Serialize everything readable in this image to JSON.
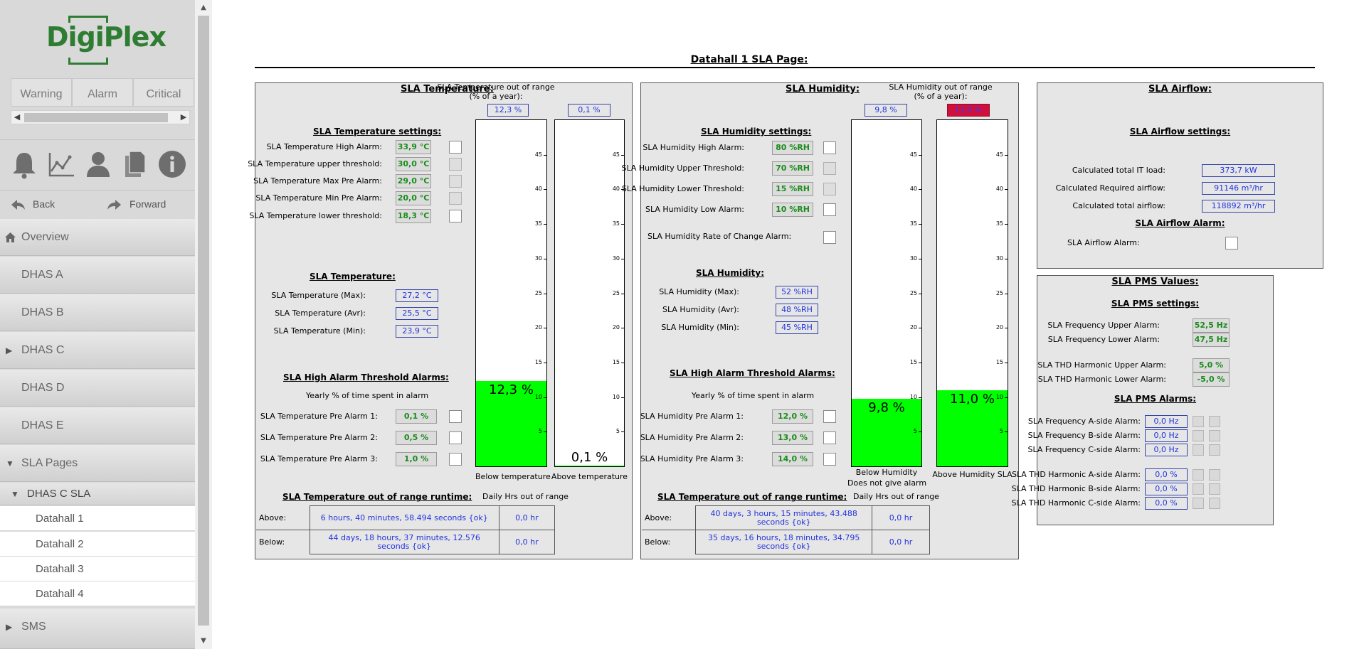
{
  "sidebar": {
    "logo_text": "DigiPlex",
    "tabs": [
      "Warning",
      "Alarm",
      "Critical"
    ],
    "icons": [
      "bell-icon",
      "chart-line-icon",
      "user-icon",
      "documents-icon",
      "info-icon"
    ],
    "back_label": "Back",
    "forward_label": "Forward",
    "menu": [
      {
        "label": "Overview",
        "icon": "home-icon"
      },
      {
        "label": "DHAS A"
      },
      {
        "label": "DHAS B"
      },
      {
        "label": "DHAS C",
        "chevron": "▶"
      },
      {
        "label": "DHAS D"
      },
      {
        "label": "DHAS E"
      },
      {
        "label": "SLA Pages",
        "chevron": "▼"
      }
    ],
    "submenu_head": {
      "label": "DHAS C SLA",
      "chevron": "▼"
    },
    "submenu_items": [
      "Datahall 1",
      "Datahall 2",
      "Datahall 3",
      "Datahall 4"
    ],
    "last_menu": {
      "label": "SMS",
      "chevron": "▶"
    }
  },
  "page": {
    "title": "Datahall 1 SLA Page:"
  },
  "temperature": {
    "title": "SLA Temperature:",
    "out_of_range_title": "SLA Temperature out of range",
    "out_of_range_sub": "(% of a year):",
    "below_pct": "12,3 %",
    "above_pct": "0,1 %",
    "settings_title": "SLA Temperature settings:",
    "settings": [
      {
        "label": "SLA Temperature High Alarm:",
        "value": "33,9 °C"
      },
      {
        "label": "SLA Temperature upper threshold:",
        "value": "30,0 °C"
      },
      {
        "label": "SLA Temperature Max Pre Alarm:",
        "value": "29,0 °C"
      },
      {
        "label": "SLA Temperature Min Pre Alarm:",
        "value": "20,0 °C"
      },
      {
        "label": "SLA Temperature lower threshold:",
        "value": "18,3 °C"
      }
    ],
    "current_title": "SLA Temperature:",
    "current": [
      {
        "label": "SLA Temperature (Max):",
        "value": "27,2 °C"
      },
      {
        "label": "SLA Temperature (Avr):",
        "value": "25,5 °C"
      },
      {
        "label": "SLA Temperature (Min):",
        "value": "23,9 °C"
      }
    ],
    "high_alarm_title": "SLA High Alarm Threshold Alarms:",
    "yearly_label": "Yearly % of time spent in alarm",
    "pre_alarms": [
      {
        "label": "SLA Temperature Pre Alarm 1:",
        "value": "0,1 %"
      },
      {
        "label": "SLA Temperature Pre Alarm 2:",
        "value": "0,5 %"
      },
      {
        "label": "SLA Temperature Pre Alarm 3:",
        "value": "1,0 %"
      }
    ],
    "bars": [
      {
        "value": 12.3,
        "label": "12,3 %",
        "caption": "Below temperature"
      },
      {
        "value": 0.1,
        "label": "0,1 %",
        "caption": "Above temperature"
      }
    ],
    "runtime_title": "SLA Temperature out of range runtime:",
    "daily_label": "Daily Hrs out of range",
    "runtime": [
      {
        "label": "Above:",
        "value": "6 hours, 40 minutes, 58.494 seconds {ok}",
        "daily": "0,0 hr"
      },
      {
        "label": "Below:",
        "value": "44 days, 18 hours, 37 minutes, 12.576 seconds {ok}",
        "daily": "0,0 hr"
      }
    ]
  },
  "humidity": {
    "title": "SLA Humidity:",
    "out_of_range_title": "SLA Humidity out of range",
    "out_of_range_sub": "(% of a year):",
    "below_pct": "9,8 %",
    "above_pct": "11,0 %",
    "settings_title": "SLA Humidity settings:",
    "settings": [
      {
        "label": "SLA Humidity High Alarm:",
        "value": "80 %RH"
      },
      {
        "label": "SLA Humidity Upper Threshold:",
        "value": "70 %RH"
      },
      {
        "label": "SLA Humidity Lower Threshold:",
        "value": "15 %RH"
      },
      {
        "label": "SLA Humidity Low Alarm:",
        "value": "10 %RH"
      }
    ],
    "rate_label": "SLA Humidity Rate of Change Alarm:",
    "current_title": "SLA Humidity:",
    "current": [
      {
        "label": "SLA Humidity (Max):",
        "value": "52 %RH"
      },
      {
        "label": "SLA Humidity (Avr):",
        "value": "48 %RH"
      },
      {
        "label": "SLA Humidity (Min):",
        "value": "45 %RH"
      }
    ],
    "high_alarm_title": "SLA High Alarm Threshold Alarms:",
    "yearly_label": "Yearly % of time spent in alarm",
    "pre_alarms": [
      {
        "label": "SLA Humidity Pre Alarm 1:",
        "value": "12,0 %"
      },
      {
        "label": "SLA Humidity Pre Alarm 2:",
        "value": "13,0 %"
      },
      {
        "label": "SLA Humidity Pre Alarm 3:",
        "value": "14,0 %"
      }
    ],
    "bars": [
      {
        "value": 9.8,
        "label": "9,8 %",
        "caption": "Below Humidity",
        "caption2": "Does not give alarm"
      },
      {
        "value": 11.0,
        "label": "11,0 %",
        "caption": "Above Humidity SLA"
      }
    ],
    "runtime_title": "SLA Temperature out of range runtime:",
    "daily_label": "Daily Hrs out of range",
    "runtime": [
      {
        "label": "Above:",
        "value": "40 days, 3 hours, 15 minutes, 43.488 seconds {ok}",
        "daily": "0,0 hr"
      },
      {
        "label": "Below:",
        "value": "35 days, 16 hours, 18 minutes, 34.795 seconds {ok}",
        "daily": "0,0 hr"
      }
    ]
  },
  "axis_ticks": [
    "45",
    "40",
    "35",
    "30",
    "25",
    "20",
    "15",
    "10",
    "5"
  ],
  "airflow": {
    "title": "SLA Airflow:",
    "settings_title": "SLA Airflow settings:",
    "rows": [
      {
        "label": "Calculated total IT load:",
        "value": "373,7 kW"
      },
      {
        "label": "Calculated Required airflow:",
        "value": "91146 m³/hr"
      },
      {
        "label": "Calculated total airflow:",
        "value": "118892 m³/hr"
      }
    ],
    "alarm_title": "SLA Airflow Alarm:",
    "alarm_label": "SLA Airflow Alarm:"
  },
  "pms": {
    "title": "SLA PMS Values:",
    "settings_title": "SLA PMS settings:",
    "settings": [
      {
        "label": "SLA Frequency Upper Alarm:",
        "value": "52,5 Hz"
      },
      {
        "label": "SLA Frequency Lower Alarm:",
        "value": "47,5 Hz"
      },
      {
        "label": "SLA THD Harmonic Upper Alarm:",
        "value": "5,0 %"
      },
      {
        "label": "SLA THD Harmonic Lower Alarm:",
        "value": "-5,0 %"
      }
    ],
    "alarms_title": "SLA PMS Alarms:",
    "alarms": [
      {
        "label": "SLA Frequency A-side Alarm:",
        "value": "0,0 Hz"
      },
      {
        "label": "SLA Frequency B-side Alarm:",
        "value": "0,0 Hz"
      },
      {
        "label": "SLA Frequency C-side Alarm:",
        "value": "0,0 Hz"
      },
      {
        "label": "SLA THD Harmonic A-side Alarm:",
        "value": "0,0 %"
      },
      {
        "label": "SLA THD Harmonic B-side Alarm:",
        "value": "0,0 %"
      },
      {
        "label": "SLA THD Harmonic C-side Alarm:",
        "value": "0,0 %"
      }
    ]
  },
  "colors": {
    "green_value": "#1b8c1b",
    "blue_value": "#2233dd",
    "bar_fill": "#00ff00",
    "alarm_red": "#d0103a",
    "logo_green": "#2e7d32"
  }
}
